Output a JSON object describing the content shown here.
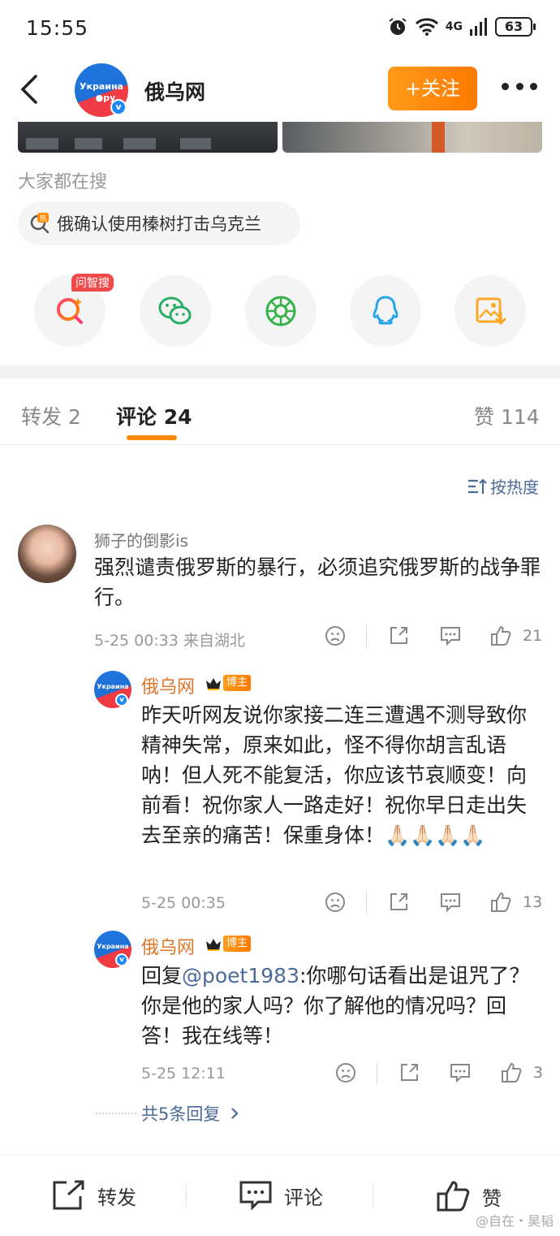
{
  "status_bar": {
    "time": "15:55",
    "network": "4G",
    "battery": "63"
  },
  "header": {
    "account_name": "俄乌网",
    "avatar_text_top": "Украина",
    "avatar_text_bottom": "●ру",
    "follow_label": "+关注"
  },
  "search": {
    "title": "大家都在搜",
    "hot_topic": "俄确认使用榛树打击乌克兰"
  },
  "share": {
    "items": [
      {
        "icon": "ai-search-icon",
        "tag": "问智搜"
      },
      {
        "icon": "wechat-icon"
      },
      {
        "icon": "moments-icon"
      },
      {
        "icon": "qq-icon"
      },
      {
        "icon": "save-image-icon"
      }
    ]
  },
  "tabs": {
    "repost": "转发",
    "repost_count": "2",
    "comment": "评论",
    "comment_count": "24",
    "like": "赞",
    "like_count": "114"
  },
  "sort_label": "按热度",
  "comments": [
    {
      "user": "狮子的倒影is",
      "text": "强烈谴责俄罗斯的暴行，必须追究俄罗斯的战争罪行。",
      "meta": "5-25 00:33 来自湖北",
      "likes": "21"
    },
    {
      "user": "俄乌网",
      "badge": "博主",
      "text": "昨天听网友说你家接二连三遭遇不测导致你精神失常，原来如此，怪不得你胡言乱语呐！但人死不能复活，你应该节哀顺变！向前看！祝你家人一路走好！祝你早日走出失去至亲的痛苦！保重身体！🙏🏻🙏🏻🙏🏻🙏🏻",
      "meta": "5-25 00:35",
      "likes": "13"
    },
    {
      "user": "俄乌网",
      "badge": "博主",
      "reply_prefix": "回复",
      "mention": "@poet1983",
      "text": ":你哪句话看出是诅咒了？你是他的家人吗？你了解他的情况吗？回答！我在线等！",
      "meta": "5-25 12:11",
      "likes": "3"
    }
  ],
  "more_replies": "共5条回复",
  "bottom_bar": {
    "repost": "转发",
    "comment": "评论",
    "like": "赞"
  },
  "watermark": "@自在・昊韬",
  "colors": {
    "accent": "#ff8a00",
    "link": "#4b6a98",
    "blogger_name": "#e0762a"
  }
}
